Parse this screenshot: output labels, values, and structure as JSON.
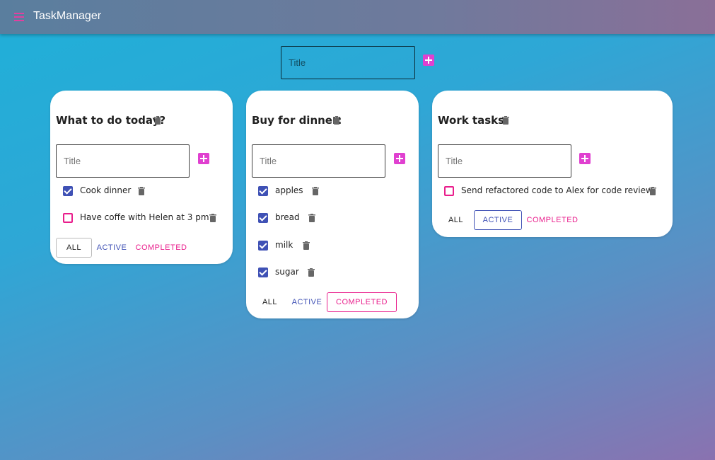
{
  "app": {
    "title": "TaskManager",
    "menu_icon": "menu-icon",
    "accent_color": "#e040d0"
  },
  "new_list": {
    "placeholder": "Title",
    "add_icon": "add-box-icon"
  },
  "lists": [
    {
      "title": "What to do today?",
      "input_placeholder": "Title",
      "tasks": [
        {
          "text": "Cook dinner",
          "done": true
        },
        {
          "text": "Have coffe with Helen at 3 pm",
          "done": false
        }
      ],
      "filters": {
        "all": "ALL",
        "active": "ACTIVE",
        "completed": "COMPLETED",
        "selected": "all"
      }
    },
    {
      "title": "Buy for dinner:",
      "input_placeholder": "Title",
      "tasks": [
        {
          "text": "apples",
          "done": true
        },
        {
          "text": "bread",
          "done": true
        },
        {
          "text": "milk",
          "done": true
        },
        {
          "text": "sugar",
          "done": true
        }
      ],
      "filters": {
        "all": "ALL",
        "active": "ACTIVE",
        "completed": "COMPLETED",
        "selected": "completed"
      }
    },
    {
      "title": "Work tasks",
      "input_placeholder": "Title",
      "tasks": [
        {
          "text": "Send refactored code to Alex for code review",
          "done": false
        }
      ],
      "filters": {
        "all": "ALL",
        "active": "ACTIVE",
        "completed": "COMPLETED",
        "selected": "active"
      }
    }
  ]
}
